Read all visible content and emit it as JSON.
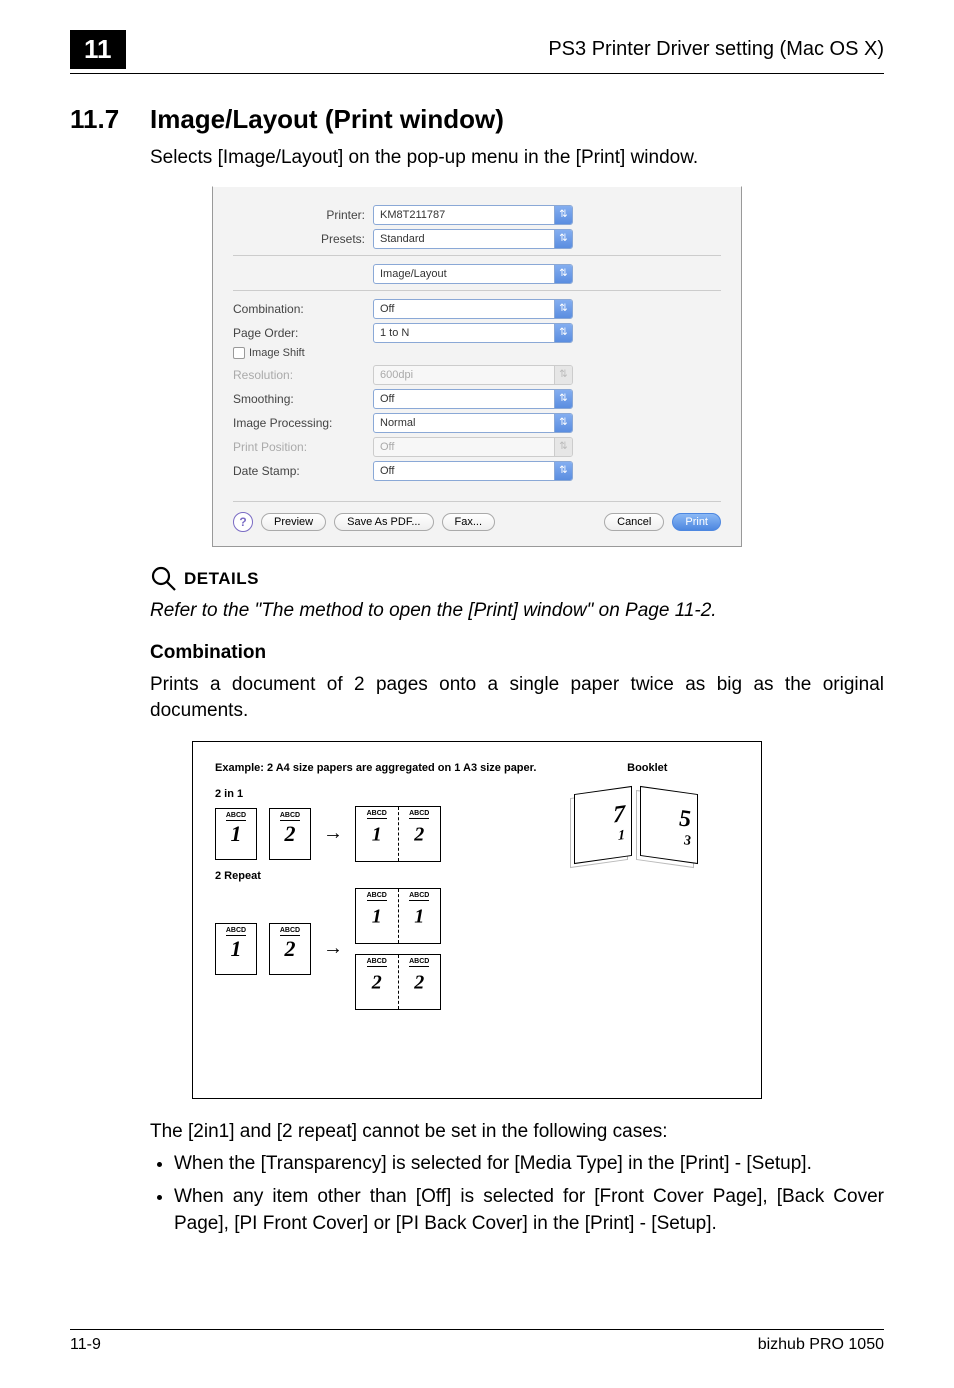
{
  "header": {
    "chapter_number": "11",
    "running_title": "PS3 Printer Driver setting (Mac OS X)"
  },
  "section": {
    "number": "11.7",
    "title": "Image/Layout (Print window)"
  },
  "intro_text": "Selects [Image/Layout] on the pop-up menu in the [Print] window.",
  "dialog": {
    "printer_label": "Printer:",
    "printer_value": "KM8T211787",
    "presets_label": "Presets:",
    "presets_value": "Standard",
    "pane_value": "Image/Layout",
    "rows": {
      "combination_label": "Combination:",
      "combination_value": "Off",
      "page_order_label": "Page Order:",
      "page_order_value": "1 to N",
      "image_shift_label": "Image Shift",
      "resolution_label": "Resolution:",
      "resolution_value": "600dpi",
      "smoothing_label": "Smoothing:",
      "smoothing_value": "Off",
      "image_processing_label": "Image Processing:",
      "image_processing_value": "Normal",
      "print_position_label": "Print Position:",
      "print_position_value": "Off",
      "date_stamp_label": "Date Stamp:",
      "date_stamp_value": "Off"
    },
    "footer_buttons": {
      "help": "?",
      "preview": "Preview",
      "save_pdf": "Save As PDF...",
      "fax": "Fax...",
      "cancel": "Cancel",
      "print": "Print"
    }
  },
  "details": {
    "label": "DETAILS",
    "body": "Refer to the \"The method to open the [Print] window\" on Page 11-2."
  },
  "combination_section": {
    "heading": "Combination",
    "body": "Prints a document of 2 pages onto a single paper twice as big as the original documents."
  },
  "diagram": {
    "header_left": "Example: 2 A4 size papers are aggregated on 1 A3 size paper.",
    "header_right": "Booklet",
    "label_2in1": "2 in 1",
    "label_2repeat": "2 Repeat",
    "abcd": "ABCD",
    "nums": {
      "one": "1",
      "two": "2",
      "three": "3",
      "five": "5",
      "seven": "7"
    }
  },
  "note_intro": "The [2in1] and [2 repeat] cannot be set in the following cases:",
  "bullets": [
    "When the [Transparency] is selected for [Media Type] in the [Print] - [Setup].",
    "When any item other than [Off] is selected for [Front Cover Page], [Back Cover Page], [PI Front Cover] or [PI Back Cover] in the [Print] - [Setup]."
  ],
  "footer": {
    "page_num": "11-9",
    "product": "bizhub PRO 1050"
  }
}
